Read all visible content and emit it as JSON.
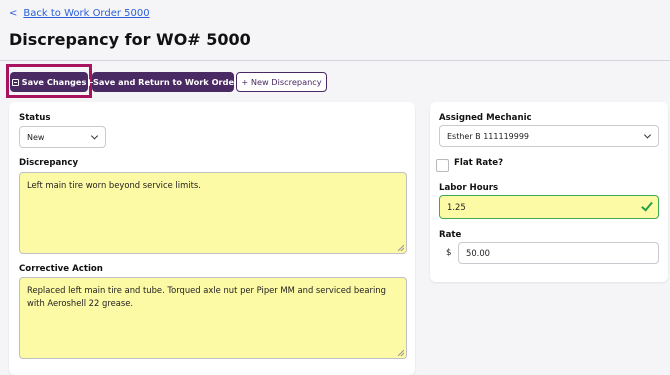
{
  "header": {
    "back_link": "Back to Work Order 5000",
    "back_chevron": "<",
    "title": "Discrepancy for WO# 5000"
  },
  "toolbar": {
    "save_label": "Save Changes",
    "save_return_label": "Save and Return to Work Order",
    "new_label": "+ New Discrepancy",
    "accent_color": "#4a2a63",
    "highlight_color": "#a8135f"
  },
  "form": {
    "status_label": "Status",
    "status_value": "New",
    "discrepancy_label": "Discrepancy",
    "discrepancy_text": "Left main tire worn beyond service limits.",
    "corrective_label": "Corrective Action",
    "corrective_text": "Replaced left main tire and tube.  Torqued axle nut per Piper MM and serviced bearing with Aeroshell 22 grease.",
    "mechanic_label": "Assigned Mechanic",
    "mechanic_value": "Esther B 111119999",
    "flat_rate_label": "Flat Rate?",
    "labor_hours_label": "Labor Hours",
    "labor_hours_value": "1.25",
    "rate_label": "Rate",
    "rate_currency": "$",
    "rate_value": "50.00",
    "field_highlight_color": "#fdfaa6",
    "valid_color": "#3daa4f"
  }
}
